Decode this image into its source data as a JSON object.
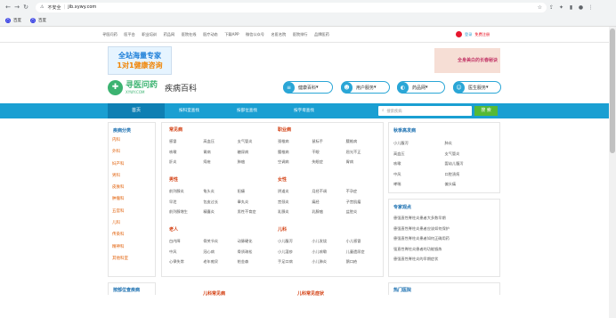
{
  "browser": {
    "security_label": "不安全",
    "url": "jib.xywy.com",
    "bookmarks": [
      "百度",
      "百度"
    ]
  },
  "topnav": {
    "links": [
      "寻医问药",
      "医平台",
      "职业培训",
      "药品网",
      "医院在线",
      "医疗动态",
      "下载APP",
      "微信公众号",
      "名医名院",
      "医院排行",
      "品牌医药"
    ],
    "login": "登录",
    "register": "免费注册"
  },
  "ads": {
    "left_line1": "全站海量专家",
    "left_line2": "1对1健康咨询",
    "right_text": "全身美白的长春秘诀"
  },
  "logo": {
    "name": "寻医问药",
    "domain": "XYWY.COM",
    "section": "疾病百科"
  },
  "services": [
    "健康百科",
    "用户服务",
    "药品网",
    "医生服务"
  ],
  "mainnav": {
    "home": "首页",
    "items": [
      "按科室查找",
      "按部位查找",
      "按字母查找"
    ],
    "search_placeholder": "搜索疾病",
    "search_button": "搜 索"
  },
  "categories": {
    "title": "疾病分类",
    "items": [
      "内科",
      "外科",
      "妇产科",
      "男科",
      "皮肤科",
      "肿瘤科",
      "五官科",
      "儿科",
      "传染科",
      "精神科",
      "其他科室"
    ]
  },
  "sections": [
    {
      "title": "常见病",
      "items": [
        "感冒",
        "高血压",
        "支气管炎",
        "咳嗽",
        "胃病",
        "糖尿病",
        "肝炎",
        "痔疮",
        "肺癌"
      ]
    },
    {
      "title": "职业病",
      "items": [
        "颈椎病",
        "鼠标手",
        "腰椎病",
        "腰椎病",
        "干眼",
        "屈光不正",
        "空调病",
        "失眠症",
        "胃病"
      ]
    },
    {
      "title": "男性",
      "items": [
        "前列腺炎",
        "龟头炎",
        "阳痿",
        "早泄",
        "包皮过长",
        "睾丸炎",
        "前列腺增生",
        "精囊炎",
        "男性不育症"
      ]
    },
    {
      "title": "女性",
      "items": [
        "阴道炎",
        "月经不调",
        "不孕症",
        "宫颈炎",
        "痛经",
        "子宫肌瘤",
        "乳腺炎",
        "乳腺癌",
        "盆腔炎"
      ]
    },
    {
      "title": "老人",
      "items": [
        "白内障",
        "骨关节炎",
        "动脉硬化",
        "中风",
        "冠心病",
        "骨质疏松",
        "心律失常",
        "老年痴呆",
        "帕金森"
      ]
    },
    {
      "title": "儿科",
      "items": [
        "小儿腹泻",
        "小儿发烧",
        "小儿感冒",
        "小儿湿疹",
        "小儿咳嗽",
        "儿童遗尿症",
        "手足口病",
        "小儿肺炎",
        "鹅口疮"
      ]
    }
  ],
  "seasonal": {
    "title": "秋季高发病",
    "items": [
      "小儿腹泻",
      "肺炎",
      "高血压",
      "支气管炎",
      "咳嗽",
      "婴幼儿腹泻",
      "中风",
      "口腔溃疡",
      "哮喘",
      "偏头痛"
    ]
  },
  "expert": {
    "title": "专家观点",
    "items": [
      "患强直性脊柱炎患者大多数早期",
      "患强直性脊柱炎患者应该如何保护",
      "患强直性脊柱炎患者如何正确用药",
      "强直性脊柱炎患者的功能锻炼",
      "患强直性脊柱炎的早期症状"
    ]
  },
  "bottom": {
    "left_title": "按部位查疾病",
    "mid1": "儿科常见病",
    "mid2": "儿科常见症状",
    "right_title": "热门医院"
  }
}
